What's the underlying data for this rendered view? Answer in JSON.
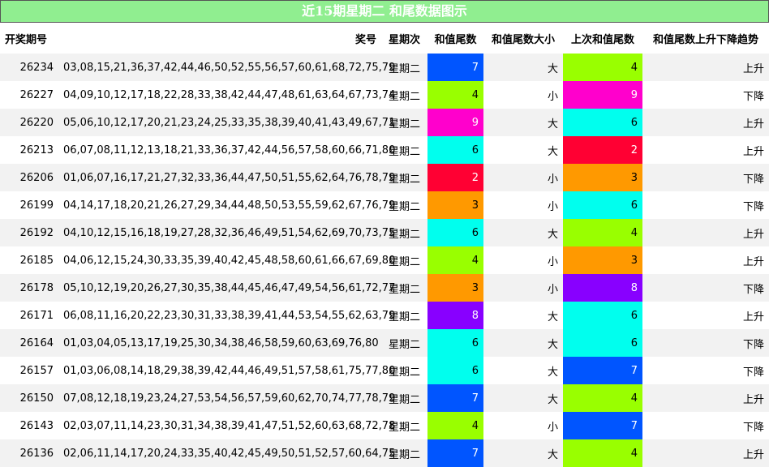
{
  "title": "近15期星期二 和尾数据图示",
  "headers": {
    "issue": "开奖期号",
    "numbers": "奖号",
    "weekday": "星期次",
    "tail": "和值尾数",
    "size": "和值尾数大小",
    "prev_tail": "上次和值尾数",
    "trend": "和值尾数上升下降趋势"
  },
  "digit_colors": {
    "2": "#ff0033",
    "3": "#ff9900",
    "4": "#99ff00",
    "6": "#00ffee",
    "7": "#0055ff",
    "8": "#8800ff",
    "9": "#ff00cc"
  },
  "light_text_digits": [
    "2",
    "7",
    "8",
    "9"
  ],
  "rows": [
    {
      "issue": "26234",
      "numbers": "03,08,15,21,36,37,42,44,46,50,52,55,56,57,60,61,68,72,75,79",
      "weekday": "星期二",
      "tail": "7",
      "size": "大",
      "prev_tail": "4",
      "trend": "上升"
    },
    {
      "issue": "26227",
      "numbers": "04,09,10,12,17,18,22,28,33,38,42,44,47,48,61,63,64,67,73,74",
      "weekday": "星期二",
      "tail": "4",
      "size": "小",
      "prev_tail": "9",
      "trend": "下降"
    },
    {
      "issue": "26220",
      "numbers": "05,06,10,12,17,20,21,23,24,25,33,35,38,39,40,41,43,49,67,71",
      "weekday": "星期二",
      "tail": "9",
      "size": "大",
      "prev_tail": "6",
      "trend": "上升"
    },
    {
      "issue": "26213",
      "numbers": "06,07,08,11,12,13,18,21,33,36,37,42,44,56,57,58,60,66,71,80",
      "weekday": "星期二",
      "tail": "6",
      "size": "大",
      "prev_tail": "2",
      "trend": "上升"
    },
    {
      "issue": "26206",
      "numbers": "01,06,07,16,17,21,27,32,33,36,44,47,50,51,55,62,64,76,78,79",
      "weekday": "星期二",
      "tail": "2",
      "size": "小",
      "prev_tail": "3",
      "trend": "下降"
    },
    {
      "issue": "26199",
      "numbers": "04,14,17,18,20,21,26,27,29,34,44,48,50,53,55,59,62,67,76,79",
      "weekday": "星期二",
      "tail": "3",
      "size": "小",
      "prev_tail": "6",
      "trend": "下降"
    },
    {
      "issue": "26192",
      "numbers": "04,10,12,15,16,18,19,27,28,32,36,46,49,51,54,62,69,70,73,75",
      "weekday": "星期二",
      "tail": "6",
      "size": "大",
      "prev_tail": "4",
      "trend": "上升"
    },
    {
      "issue": "26185",
      "numbers": "04,06,12,15,24,30,33,35,39,40,42,45,48,58,60,61,66,67,69,80",
      "weekday": "星期二",
      "tail": "4",
      "size": "小",
      "prev_tail": "3",
      "trend": "上升"
    },
    {
      "issue": "26178",
      "numbers": "05,10,12,19,20,26,27,30,35,38,44,45,46,47,49,54,56,61,72,77",
      "weekday": "星期二",
      "tail": "3",
      "size": "小",
      "prev_tail": "8",
      "trend": "下降"
    },
    {
      "issue": "26171",
      "numbers": "06,08,11,16,20,22,23,30,31,33,38,39,41,44,53,54,55,62,63,79",
      "weekday": "星期二",
      "tail": "8",
      "size": "大",
      "prev_tail": "6",
      "trend": "上升"
    },
    {
      "issue": "26164",
      "numbers": "01,03,04,05,13,17,19,25,30,34,38,46,58,59,60,63,69,76,80",
      "weekday": "星期二",
      "tail": "6",
      "size": "大",
      "prev_tail": "6",
      "trend": "下降"
    },
    {
      "issue": "26157",
      "numbers": "01,03,06,08,14,18,29,38,39,42,44,46,49,51,57,58,61,75,77,80",
      "weekday": "星期二",
      "tail": "6",
      "size": "大",
      "prev_tail": "7",
      "trend": "下降"
    },
    {
      "issue": "26150",
      "numbers": "07,08,12,18,19,23,24,27,53,54,56,57,59,60,62,70,74,77,78,79",
      "weekday": "星期二",
      "tail": "7",
      "size": "大",
      "prev_tail": "4",
      "trend": "上升"
    },
    {
      "issue": "26143",
      "numbers": "02,03,07,11,14,23,30,31,34,38,39,41,47,51,52,60,63,68,72,78",
      "weekday": "星期二",
      "tail": "4",
      "size": "小",
      "prev_tail": "7",
      "trend": "下降"
    },
    {
      "issue": "26136",
      "numbers": "02,06,11,14,17,20,24,33,35,40,42,45,49,50,51,52,57,60,64,75",
      "weekday": "星期二",
      "tail": "7",
      "size": "大",
      "prev_tail": "4",
      "trend": "上升"
    }
  ]
}
